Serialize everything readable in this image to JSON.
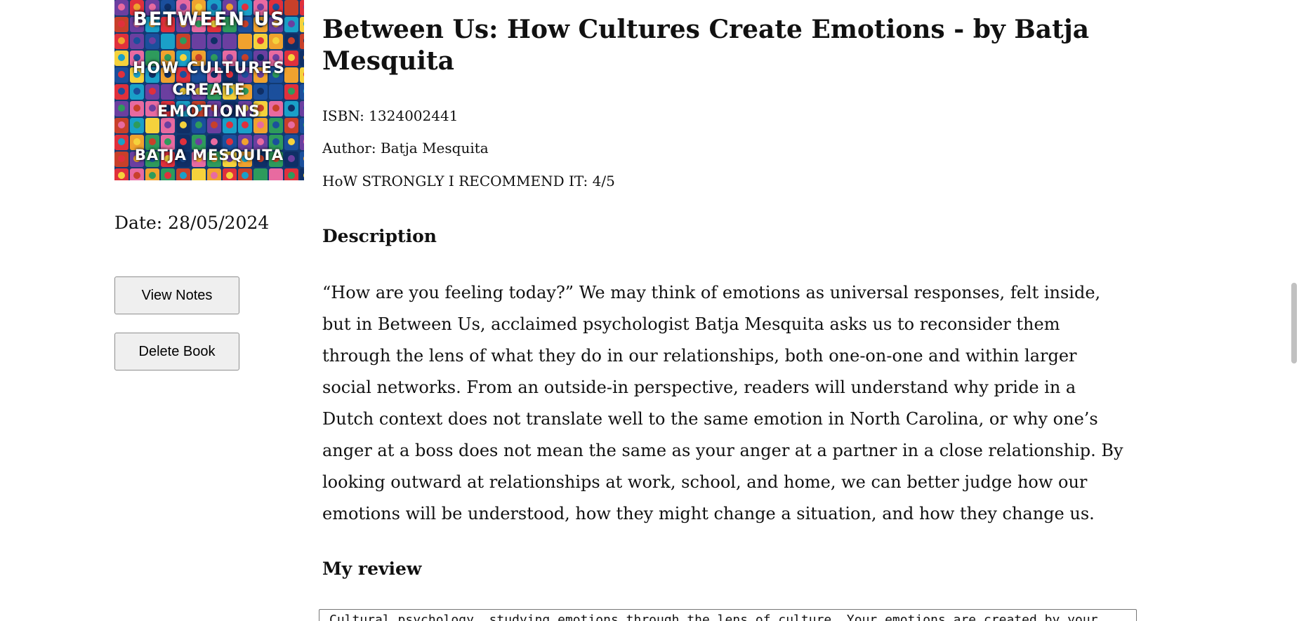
{
  "book": {
    "cover": {
      "title": "BETWEEN US",
      "subtitle_lines": [
        "HOW CULTURES",
        "CREATE",
        "EMOTIONS"
      ],
      "author": "BATJA MESQUITA",
      "palette": [
        "#1b4f9c",
        "#e0303c",
        "#f0a22e",
        "#2e9b5c",
        "#6b3fa0",
        "#e86aa0",
        "#1aa0c8",
        "#f5d23c",
        "#0f2f66",
        "#c8402a"
      ]
    },
    "title": "Between Us: How Cultures Create Emotions - by Batja Mesquita",
    "isbn": "ISBN: 1324002441",
    "author": "Author: Batja Mesquita",
    "rating": "HoW STRONGLY I RECOMMEND IT: 4/5",
    "date": "Date: 28/05/2024"
  },
  "actions": {
    "view_notes": "View Notes",
    "delete_book": "Delete Book"
  },
  "sections": {
    "description_heading": "Description",
    "description_text": "“How are you feeling today?” We may think of emotions as universal responses, felt inside, but in Between Us, acclaimed psychologist Batja Mesquita asks us to reconsider them through the lens of what they do in our relationships, both one-on-one and within larger social networks. From an outside-in perspective, readers will understand why pride in a Dutch context does not translate well to the same emotion in North Carolina, or why one’s anger at a boss does not mean the same as your anger at a partner in a close relationship. By looking outward at relationships at work, school, and home, we can better judge how our emotions will be understood, how they might change a situation, and how they change us.",
    "review_heading": "My review",
    "review_text": "Cultural psychology, studying emotions through the lens of culture. Your emotions are created by your"
  }
}
